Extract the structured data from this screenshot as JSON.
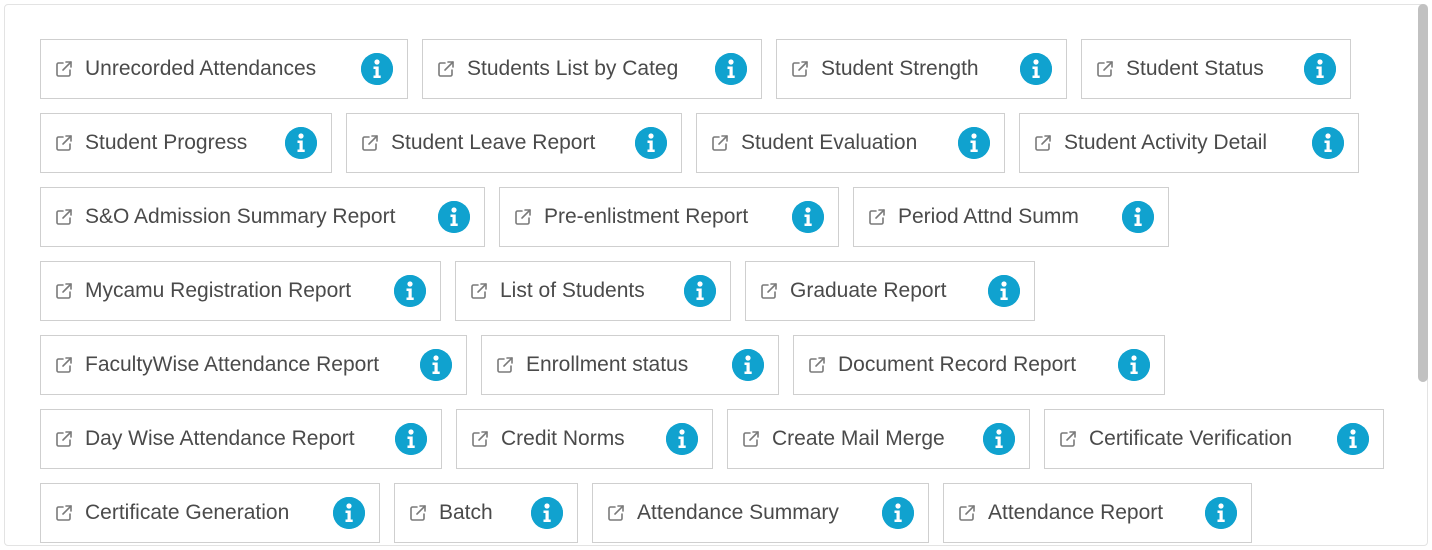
{
  "icons": {
    "launch": "external-link-icon",
    "info": "info-circle-icon"
  },
  "colors": {
    "info_accent": "#10a2cf",
    "label_text": "#4a4a4a",
    "tile_border": "#cfcfcf"
  },
  "reports": [
    [
      {
        "label": "Unrecorded Attendances"
      },
      {
        "label": "Students List by Categ"
      },
      {
        "label": "Student Strength"
      },
      {
        "label": "Student Status"
      }
    ],
    [
      {
        "label": "Student Progress"
      },
      {
        "label": "Student Leave Report"
      },
      {
        "label": "Student Evaluation"
      },
      {
        "label": "Student Activity Detail"
      }
    ],
    [
      {
        "label": "S&O Admission Summary Report"
      },
      {
        "label": "Pre-enlistment Report"
      },
      {
        "label": "Period Attnd Summ"
      }
    ],
    [
      {
        "label": "Mycamu Registration Report"
      },
      {
        "label": "List of Students"
      },
      {
        "label": "Graduate Report"
      }
    ],
    [
      {
        "label": "FacultyWise Attendance Report"
      },
      {
        "label": "Enrollment status"
      },
      {
        "label": "Document Record Report"
      }
    ],
    [
      {
        "label": "Day Wise Attendance Report"
      },
      {
        "label": "Credit Norms"
      },
      {
        "label": "Create Mail Merge"
      },
      {
        "label": "Certificate Verification"
      }
    ],
    [
      {
        "label": "Certificate Generation"
      },
      {
        "label": "Batch"
      },
      {
        "label": "Attendance Summary"
      },
      {
        "label": "Attendance Report"
      }
    ]
  ]
}
